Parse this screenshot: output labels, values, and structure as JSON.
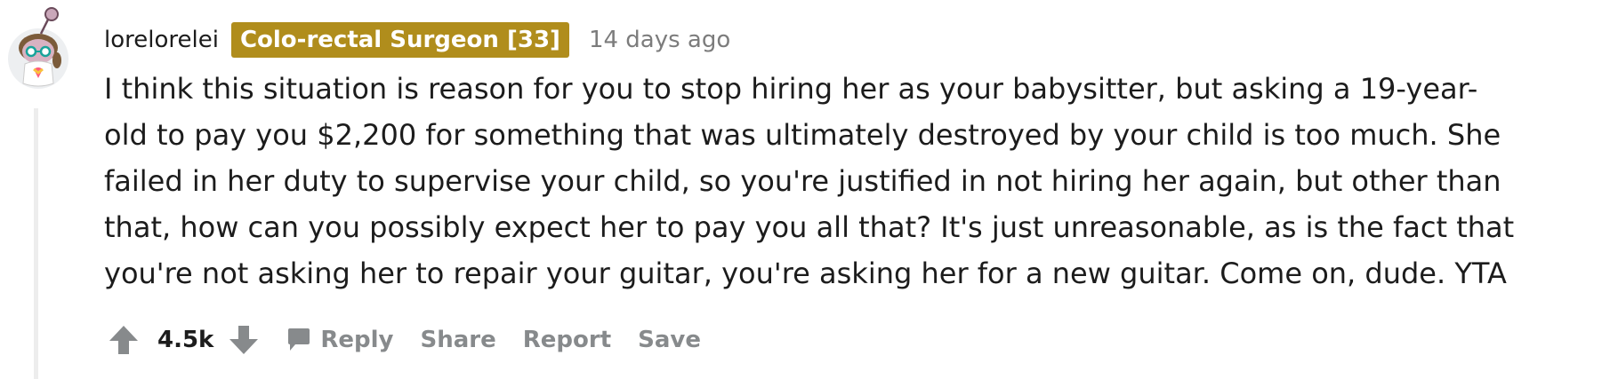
{
  "comment": {
    "author": "lorelorelei",
    "flair": "Colo-rectal Surgeon [33]",
    "timestamp": "14 days ago",
    "body_lines": [
      "I think this situation is reason for you to stop hiring her as your babysitter, but asking a 19-year-",
      "old to pay you $2,200 for something that was ultimately destroyed by your child is too much. She",
      "failed in her duty to supervise your child, so you're justified in not hiring her again, but other than",
      "that, how can you possibly expect her to pay you all that? It's just unreasonable, as is the fact that",
      "you're not asking her to repair your guitar, you're asking her for a new guitar. Come on, dude. YTA"
    ],
    "score": "4.5k"
  },
  "actions": {
    "reply_label": "Reply",
    "share_label": "Share",
    "report_label": "Report",
    "save_label": "Save"
  },
  "icons": {
    "upvote": "arrow-up-icon",
    "downvote": "arrow-down-icon",
    "reply": "speech-bubble-icon",
    "avatar": "snoo-avatar"
  },
  "colors": {
    "flair_bg": "#b08d1c",
    "flair_text": "#ffffff",
    "muted": "#878a8c",
    "text": "#1c1c1c",
    "thread_line": "#ededed"
  }
}
